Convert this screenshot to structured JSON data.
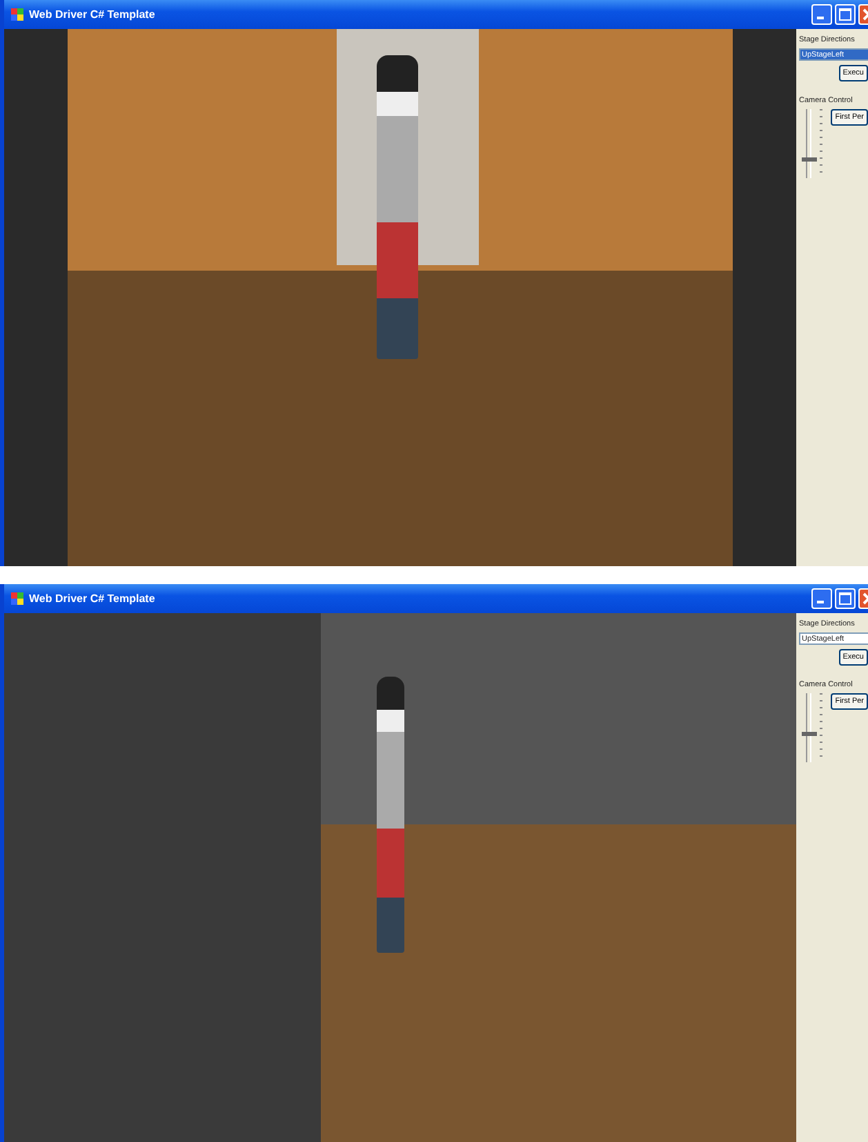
{
  "windows": [
    {
      "title": "Web Driver C# Template",
      "scene": {
        "kind": "front"
      },
      "panel": {
        "stage_label": "Stage Directions",
        "stage_field": {
          "value": "UpStageLeft",
          "selected": true
        },
        "execute_button": "Execu",
        "camera_label": "Camera Control",
        "camera_button": "First Per",
        "camera_slider": {
          "level": 0.25
        }
      }
    },
    {
      "title": "Web Driver C# Template",
      "scene": {
        "kind": "side"
      },
      "panel": {
        "stage_label": "Stage Directions",
        "stage_field": {
          "value": "UpStageLeft",
          "selected": false
        },
        "execute_button": "Execu",
        "camera_label": "Camera Control",
        "camera_button": "First Per",
        "camera_slider": {
          "level": 0.4
        }
      }
    }
  ]
}
